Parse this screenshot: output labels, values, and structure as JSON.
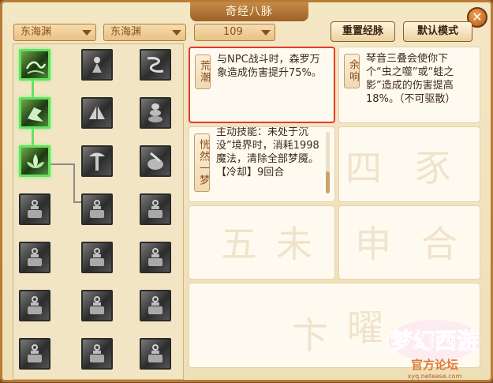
{
  "window": {
    "title": "奇经八脉",
    "close_glyph": "✕"
  },
  "toolbar": {
    "dropdown1": "东海渊",
    "dropdown2": "东海渊",
    "dropdown3": "109",
    "reset_label": "重置经脉",
    "default_label": "默认模式"
  },
  "cards": [
    {
      "tag": "荒潮",
      "desc": "与NPC战斗时，森罗万象造成伤害提升75%。"
    },
    {
      "tag": "余响",
      "desc": "琴音三叠会使你下个“虫之噬”或“蛙之影”造成的伤害提高18%。（不可驱散）"
    },
    {
      "tag": "恍然一梦",
      "desc_line1": "主动技能：未处于沉没”境界时，消耗1998魔法，清除全部梦魇。",
      "desc_line2": "【冷却】9回合"
    }
  ],
  "watermark_chars": [
    "四",
    "豕",
    "五",
    "未",
    "申",
    "合",
    "卞",
    "曜"
  ],
  "logo": {
    "brand": "梦幻西游",
    "sub": "官方论坛",
    "url": "xyq.netease.com"
  },
  "skills_grid_note": "7 rows x 3 columns"
}
